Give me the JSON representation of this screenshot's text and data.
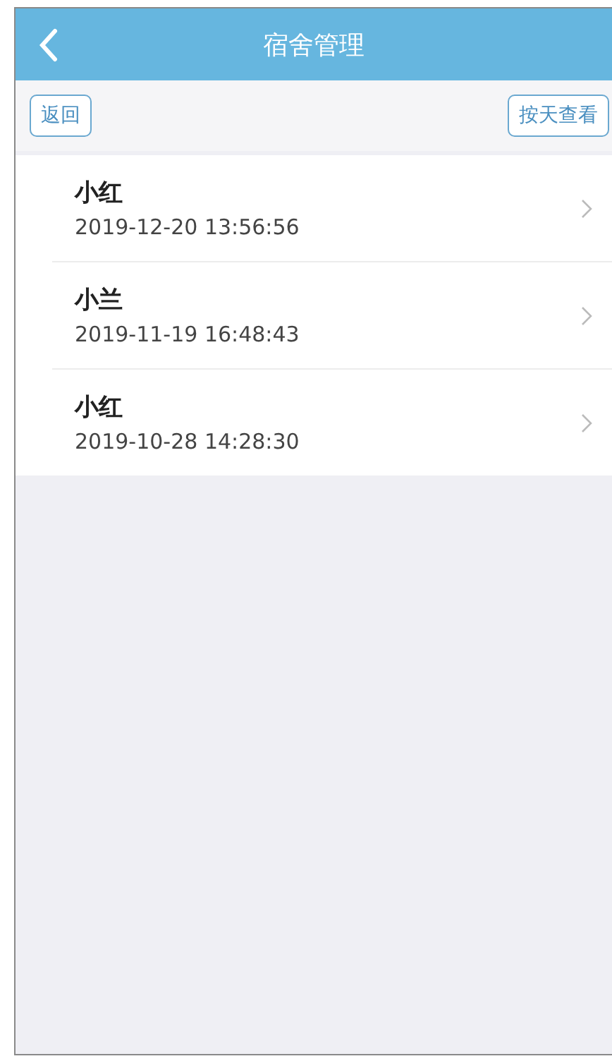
{
  "header": {
    "title": "宿舍管理"
  },
  "toolbar": {
    "left_button": "返回",
    "right_button": "按天查看"
  },
  "records": [
    {
      "name": "小红",
      "time": "2019-12-20 13:56:56"
    },
    {
      "name": "小兰",
      "time": "2019-11-19 16:48:43"
    },
    {
      "name": "小红",
      "time": "2019-10-28 14:28:30"
    }
  ]
}
